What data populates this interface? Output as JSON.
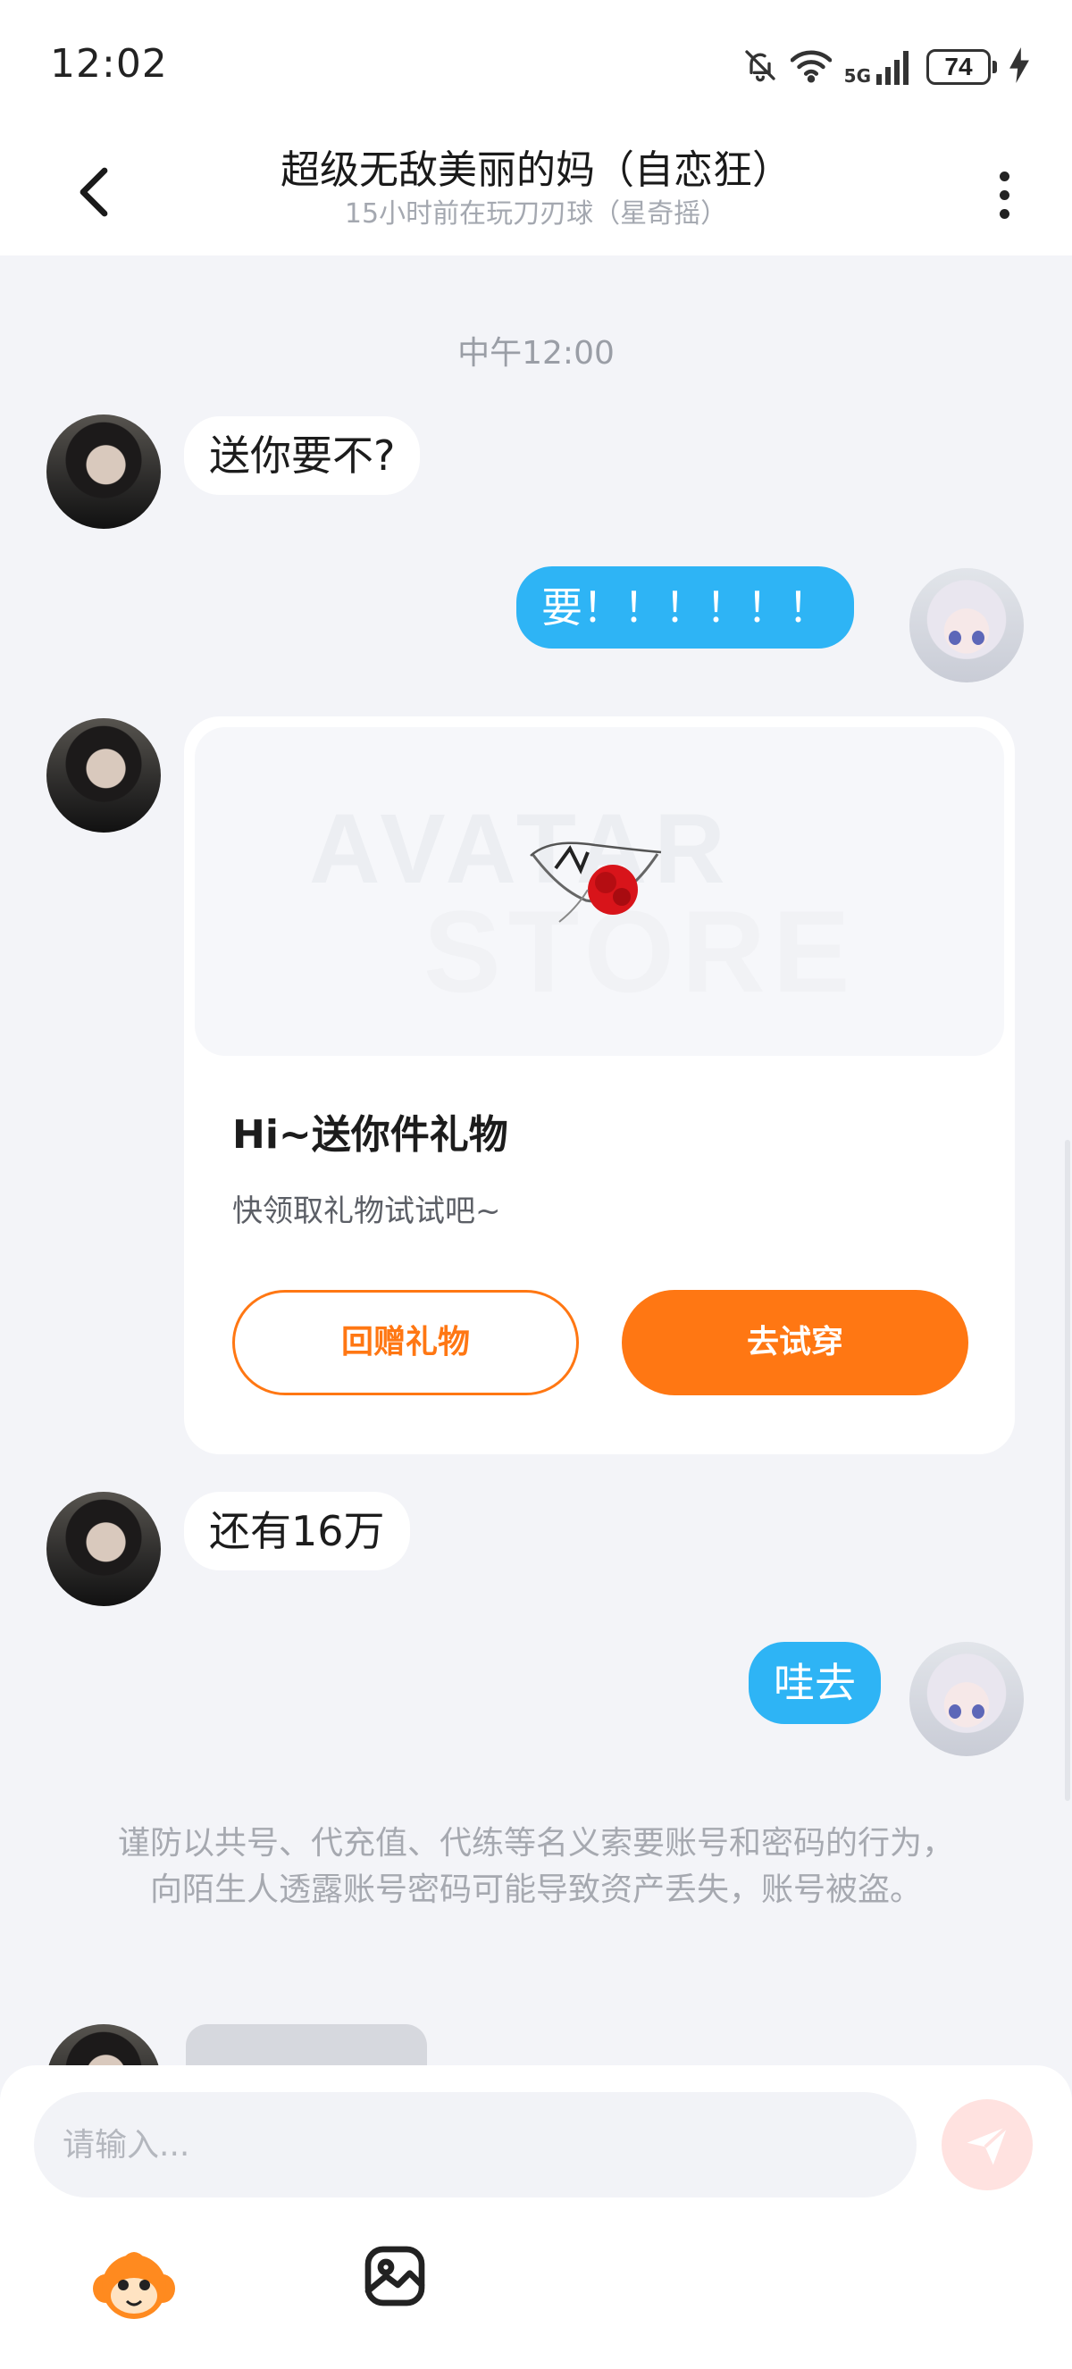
{
  "status_bar": {
    "time": "12:02",
    "network": "5G",
    "battery": "74",
    "icons": [
      "bell-off-icon",
      "wifi-icon",
      "signal-icon",
      "battery-icon",
      "charging-icon"
    ]
  },
  "header": {
    "title": "超级无敌美丽的妈（自恋狂）",
    "subtitle": "15小时前在玩刀刃球（星奇摇）",
    "back_icon": "chevron-left-icon",
    "more_icon": "more-vertical-icon"
  },
  "chat": {
    "timestamp": "中午12:00",
    "messages": [
      {
        "side": "incoming",
        "text": "送你要不?"
      },
      {
        "side": "outgoing",
        "text": "要！！！！！！"
      },
      {
        "side": "incoming",
        "type": "gift_card"
      },
      {
        "side": "incoming",
        "text": "还有16万"
      },
      {
        "side": "outgoing",
        "text": "哇去"
      }
    ],
    "gift_card": {
      "watermark_line1": "AVATAR",
      "watermark_line2": "STORE",
      "title": "Hi~送你件礼物",
      "description": "快领取礼物试试吧~",
      "return_gift_label": "回赠礼物",
      "try_on_label": "去试穿",
      "accent_color": "#ff7713"
    },
    "safety_notice": "谨防以共号、代充值、代练等名义索要账号和密码的行为，向陌生人透露账号密码可能导致资产丢失，账号被盗。"
  },
  "input_bar": {
    "placeholder": "请输入...",
    "send_icon": "send-icon",
    "tools": [
      "mascot-icon",
      "image-icon"
    ]
  },
  "colors": {
    "outgoing_bubble": "#2eb4f5",
    "background": "#f3f4f8",
    "accent": "#ff7713"
  }
}
